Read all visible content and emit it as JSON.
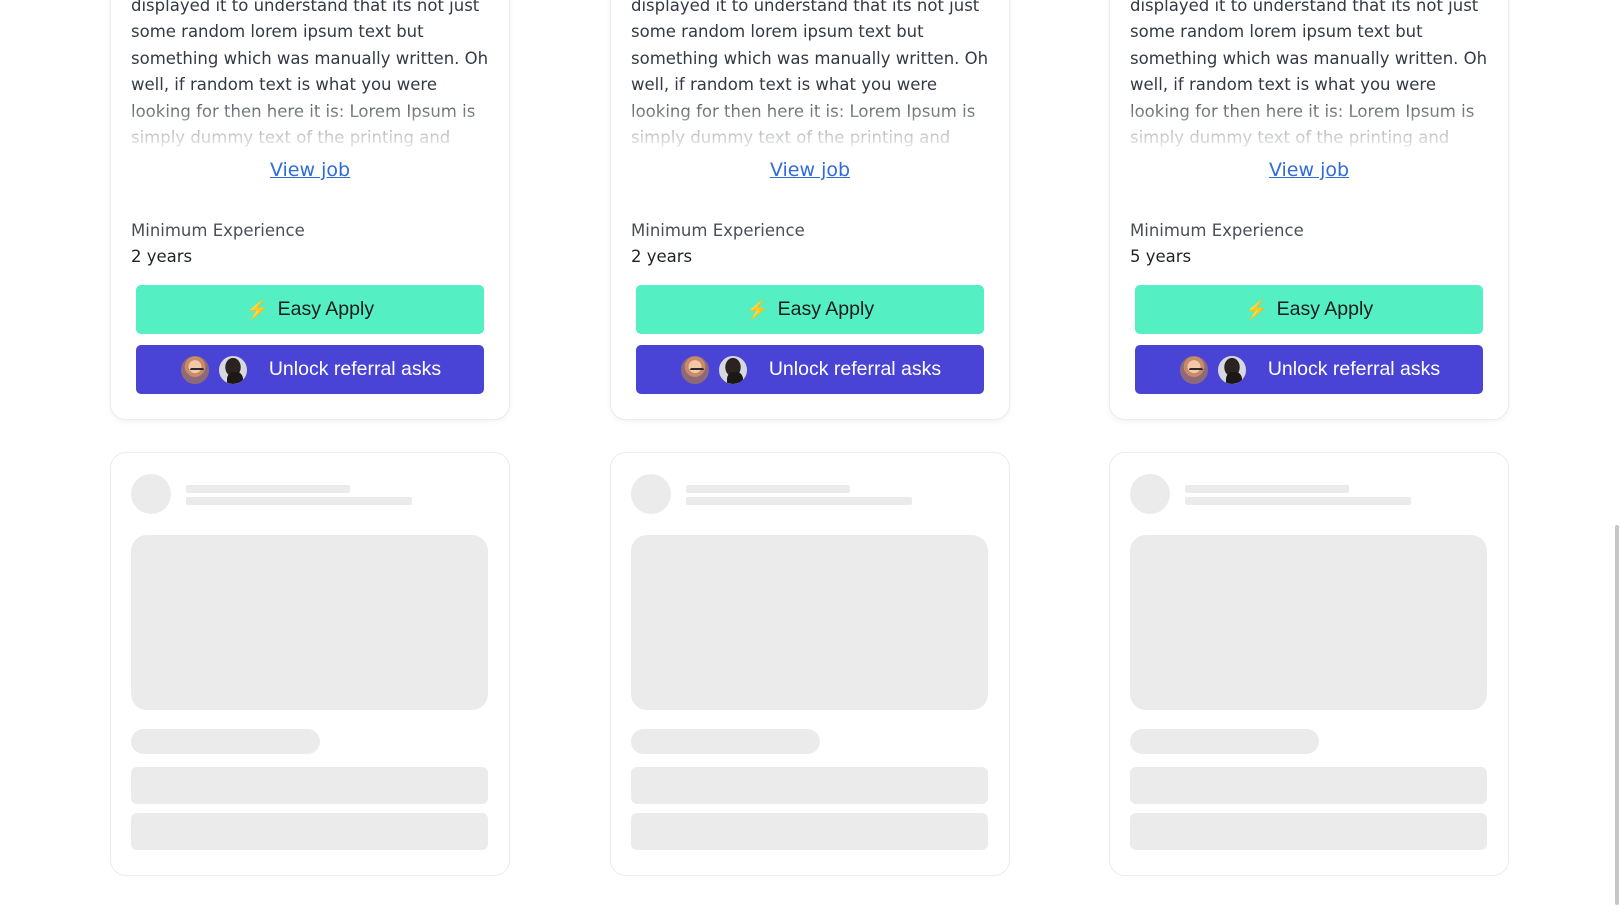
{
  "jobs": [
    {
      "description_partial": "displayed it to understand that its not just some random lorem ipsum text but something which was manually written. Oh well, if random text is what you were looking for then here it is: Lorem Ipsum is simply dummy text of the printing and typesetting industry. Lorem Ipsum has been the",
      "view_job_label": "View job",
      "min_experience_label": "Minimum Experience",
      "min_experience_value": "2 years",
      "easy_apply_label": "Easy Apply",
      "easy_apply_icon": "lightning-bolt-icon",
      "referral_label": "Unlock referral asks"
    },
    {
      "description_partial": "displayed it to understand that its not just some random lorem ipsum text but something which was manually written. Oh well, if random text is what you were looking for then here it is: Lorem Ipsum is simply dummy text of the printing and typesetting industry. Lorem Ipsum has been the",
      "view_job_label": "View job",
      "min_experience_label": "Minimum Experience",
      "min_experience_value": "2 years",
      "easy_apply_label": "Easy Apply",
      "easy_apply_icon": "lightning-bolt-icon",
      "referral_label": "Unlock referral asks"
    },
    {
      "description_partial": "displayed it to understand that its not just some random lorem ipsum text but something which was manually written. Oh well, if random text is what you were looking for then here it is: Lorem Ipsum is simply dummy text of the printing and typesetting industry. Lorem Ipsum has been the",
      "view_job_label": "View job",
      "min_experience_label": "Minimum Experience",
      "min_experience_value": "5 years",
      "easy_apply_label": "Easy Apply",
      "easy_apply_icon": "lightning-bolt-icon",
      "referral_label": "Unlock referral asks"
    }
  ],
  "skeleton_cards_count": 3,
  "colors": {
    "easy_apply_bg": "#55efc4",
    "referral_bg": "#4a44d6",
    "link": "#2f6bd9",
    "skeleton": "#ebebeb",
    "bolt": "#f5b800"
  }
}
